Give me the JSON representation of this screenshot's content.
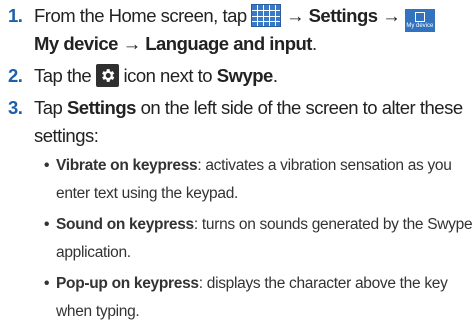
{
  "steps": [
    {
      "number": "1.",
      "prefix": "From the Home screen, tap",
      "arrow1": "→",
      "settings": "Settings",
      "arrow2": "→",
      "mydevice_icon_label": "My device",
      "line2": "My device → Language and input",
      "line2_end": "."
    },
    {
      "number": "2.",
      "prefix": "Tap the",
      "middle": "icon next to",
      "swype": "Swype",
      "end": "."
    },
    {
      "number": "3.",
      "prefix": "Tap",
      "settings": "Settings",
      "line1_rest": "on the left side of the screen to alter these",
      "line2": "settings:"
    }
  ],
  "bullets": [
    {
      "term": "Vibrate on keypress",
      "line1": ": activates a vibration sensation as you",
      "line2": "enter text using the keypad."
    },
    {
      "term": "Sound on keypress",
      "line1": ": turns on sounds generated by the Swype",
      "line2": "application."
    },
    {
      "term": "Pop-up on keypress",
      "line1": ": displays the character above the key",
      "line2": "when typing."
    }
  ],
  "icons": {
    "apps": "apps-grid-icon",
    "mydevice": "my-device-icon",
    "gear": "gear-icon",
    "apps_color": "#3a78c8",
    "gear_color": "#2f2f2f"
  }
}
